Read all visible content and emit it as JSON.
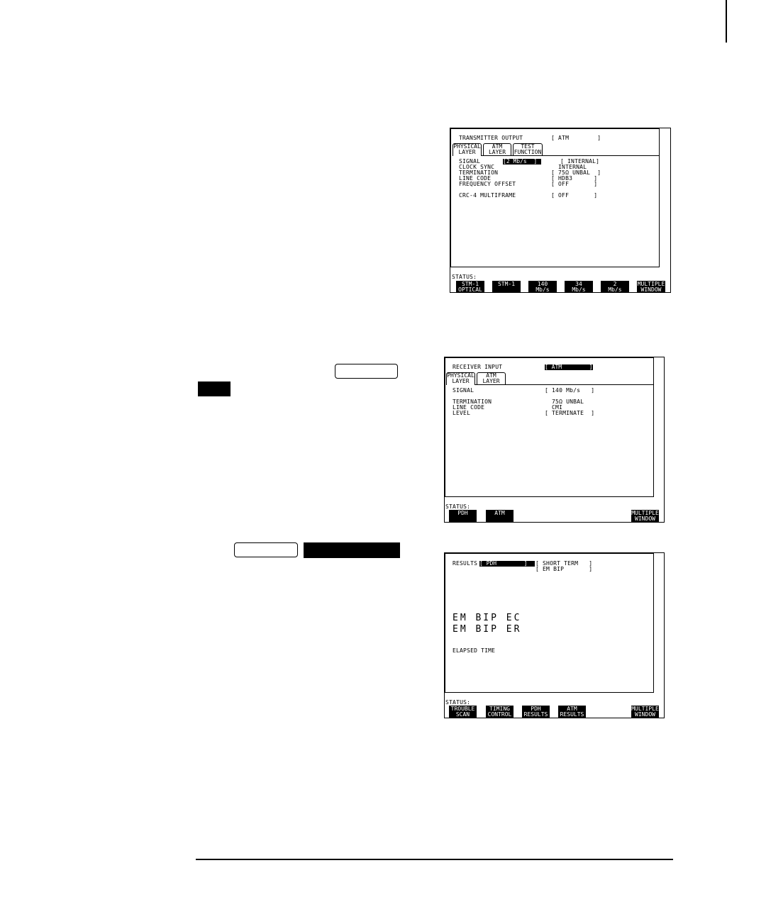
{
  "tx_screen": {
    "title_label": "TRANSMITTER OUTPUT",
    "title_value": "[ ATM        ]",
    "tabs": [
      {
        "line1": "PHYSICAL",
        "line2": "LAYER"
      },
      {
        "line1": "ATM",
        "line2": "LAYER"
      },
      {
        "line1": "TEST",
        "line2": "FUNCTION"
      }
    ],
    "rows": [
      {
        "label": "SIGNAL",
        "value": "[ INTERNAL]"
      },
      {
        "label": "CLOCK SYNC",
        "value": "  INTERNAL"
      },
      {
        "label": "TERMINATION",
        "value": "[ 75Ω UNBAL  ]"
      },
      {
        "label": "LINE CODE",
        "value": "[ HDB3      ]"
      },
      {
        "label": "FREQUENCY OFFSET",
        "value": "[ OFF       ]"
      },
      {
        "label": "CRC-4 MULTIFRAME",
        "value": "[ OFF       ]"
      }
    ],
    "signal_selected": "[2 Mb/s  ]",
    "status_label": "STATUS:",
    "softkeys": [
      {
        "line1": "STM-1",
        "line2": "OPTICAL"
      },
      {
        "line1": "STM-1",
        "line2": ""
      },
      {
        "line1": "140",
        "line2": "Mb/s"
      },
      {
        "line1": "34",
        "line2": "Mb/s"
      },
      {
        "line1": "2",
        "line2": "Mb/s"
      },
      {
        "line1": "MULTIPLE",
        "line2": "WINDOW"
      }
    ]
  },
  "rx_screen": {
    "title_label": "RECEIVER INPUT",
    "title_value": "[ ATM        ]",
    "tabs": [
      {
        "line1": "PHYSICAL",
        "line2": "LAYER"
      },
      {
        "line1": "ATM",
        "line2": "LAYER"
      }
    ],
    "rows": [
      {
        "label": "SIGNAL",
        "value": "[ 140 Mb/s   ]"
      },
      {
        "label": "TERMINATION",
        "value": "  75Ω UNBAL"
      },
      {
        "label": "LINE CODE",
        "value": "  CMI"
      },
      {
        "label": "LEVEL",
        "value": "[ TERMINATE  ]"
      }
    ],
    "status_label": "STATUS:",
    "softkeys": [
      {
        "line1": "PDH",
        "line2": ""
      },
      {
        "line1": "ATM",
        "line2": ""
      },
      {
        "line1": "MULTIPLE",
        "line2": "WINDOW"
      }
    ]
  },
  "results_screen": {
    "results_label": "RESULTS",
    "results_selected": "[ PDH        ]",
    "results_term": "[ SHORT TERM   ]",
    "results_type": "[ EM BIP       ]",
    "big_rows": [
      "EM BIP EC",
      "EM BIP ER"
    ],
    "elapsed_label": "ELAPSED TIME",
    "status_label": "STATUS:",
    "softkeys": [
      {
        "line1": "TROUBLE",
        "line2": "SCAN"
      },
      {
        "line1": "TIMING",
        "line2": "CONTROL"
      },
      {
        "line1": "PDH",
        "line2": "RESULTS"
      },
      {
        "line1": "ATM",
        "line2": "RESULTS"
      },
      {
        "line1": "MULTIPLE",
        "line2": "WINDOW"
      }
    ]
  }
}
